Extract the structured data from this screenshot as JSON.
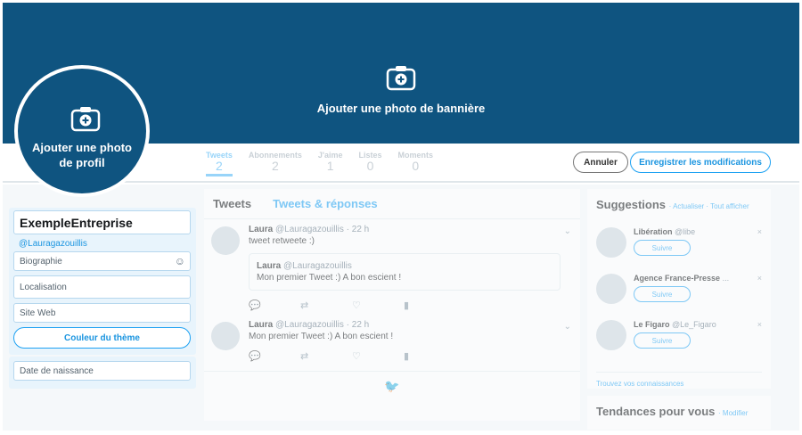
{
  "banner": {
    "label": "Ajouter une photo de bannière",
    "icon": "camera-plus-icon",
    "color": "#0f5480"
  },
  "avatar": {
    "label": "Ajouter une photo de profil",
    "icon": "camera-plus-icon"
  },
  "stats": [
    {
      "label": "Tweets",
      "value": "2"
    },
    {
      "label": "Abonnements",
      "value": "2"
    },
    {
      "label": "J'aime",
      "value": "1"
    },
    {
      "label": "Listes",
      "value": "0"
    },
    {
      "label": "Moments",
      "value": "0"
    }
  ],
  "actions": {
    "cancel": "Annuler",
    "save": "Enregistrer les modifications"
  },
  "profile": {
    "name": "ExempleEntreprise",
    "handle": "@Lauragazouillis",
    "bio_placeholder": "Biographie",
    "location_placeholder": "Localisation",
    "website_placeholder": "Site Web",
    "theme_button": "Couleur du thème",
    "birthdate_placeholder": "Date de naissance"
  },
  "timeline": {
    "tabs": [
      "Tweets",
      "Tweets & réponses"
    ],
    "tweets": [
      {
        "author": "Laura",
        "handle": "@Lauragazouillis",
        "time": "22 h",
        "text": "tweet retweete :)",
        "quote": {
          "author": "Laura",
          "handle": "@Lauragazouillis",
          "text": "Mon premier Tweet :) A bon escient !"
        }
      },
      {
        "author": "Laura",
        "handle": "@Lauragazouillis",
        "time": "22 h",
        "text": "Mon premier Tweet :) A bon escient !"
      }
    ]
  },
  "suggestions": {
    "title": "Suggestions",
    "refresh": "· Actualiser · Tout afficher",
    "follow_label": "Suivre",
    "items": [
      {
        "name": "Libération",
        "handle": "@libe"
      },
      {
        "name": "Agence France-Presse",
        "handle": "..."
      },
      {
        "name": "Le Figaro",
        "handle": "@Le_Figaro"
      }
    ],
    "find": "Trouvez vos connaissances"
  },
  "trends": {
    "title": "Tendances pour vous",
    "edit": "· Modifier"
  },
  "colors": {
    "accent": "#1da1f2",
    "banner": "#0f5480"
  }
}
